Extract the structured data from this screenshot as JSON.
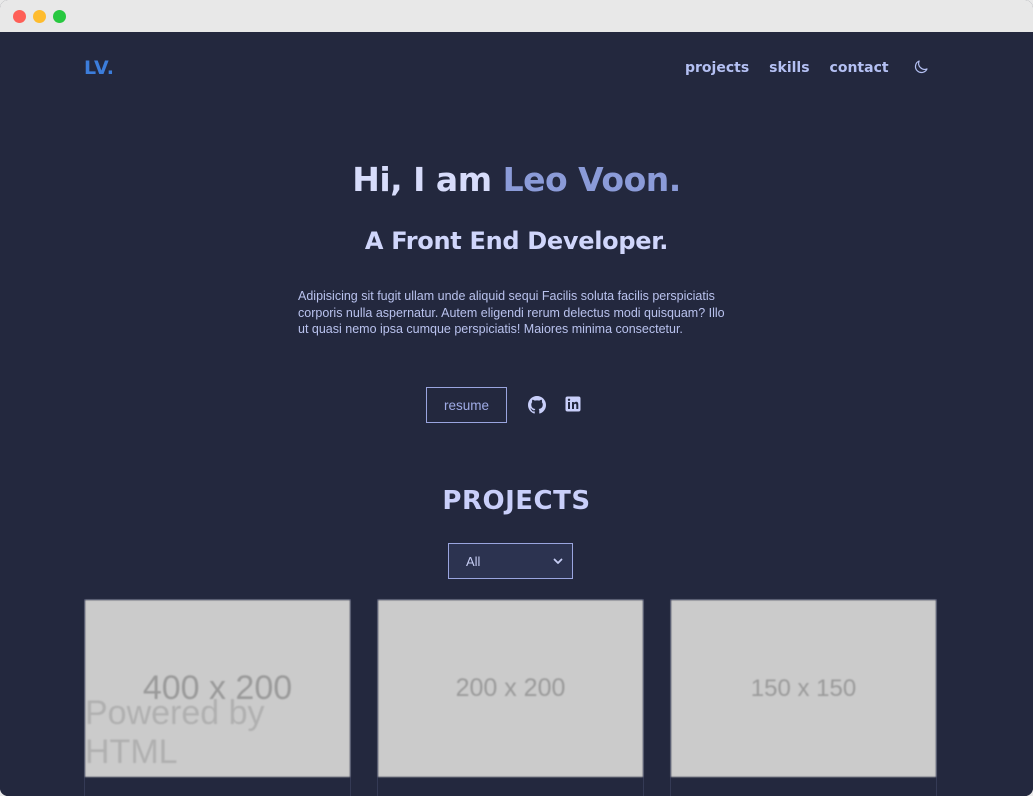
{
  "header": {
    "logo": "LV.",
    "nav": [
      "projects",
      "skills",
      "contact"
    ],
    "theme_icon": "moon-icon"
  },
  "hero": {
    "greeting": "Hi, I am",
    "name": "Leo Voon.",
    "subtitle": "A Front End Developer.",
    "description": "Adipisicing sit fugit ullam unde aliquid sequi Facilis soluta facilis perspiciatis corporis nulla aspernatur. Autem eligendi rerum delectus modi quisquam? Illo ut quasi nemo ipsa cumque perspiciatis! Maiores minima consectetur.",
    "resume_label": "resume",
    "social_icons": [
      "github-icon",
      "linkedin-icon"
    ]
  },
  "projects": {
    "title": "PROJECTS",
    "filter_value": "All",
    "cards": [
      {
        "placeholder": "400 x 200",
        "powered": "Powered by HTML"
      },
      {
        "placeholder": "200 x 200"
      },
      {
        "placeholder": "150 x 150"
      }
    ]
  },
  "colors": {
    "background": "#23283e",
    "accent": "#8b9bd8",
    "logo": "#3c7ddb",
    "text": "#d7dcfb"
  }
}
